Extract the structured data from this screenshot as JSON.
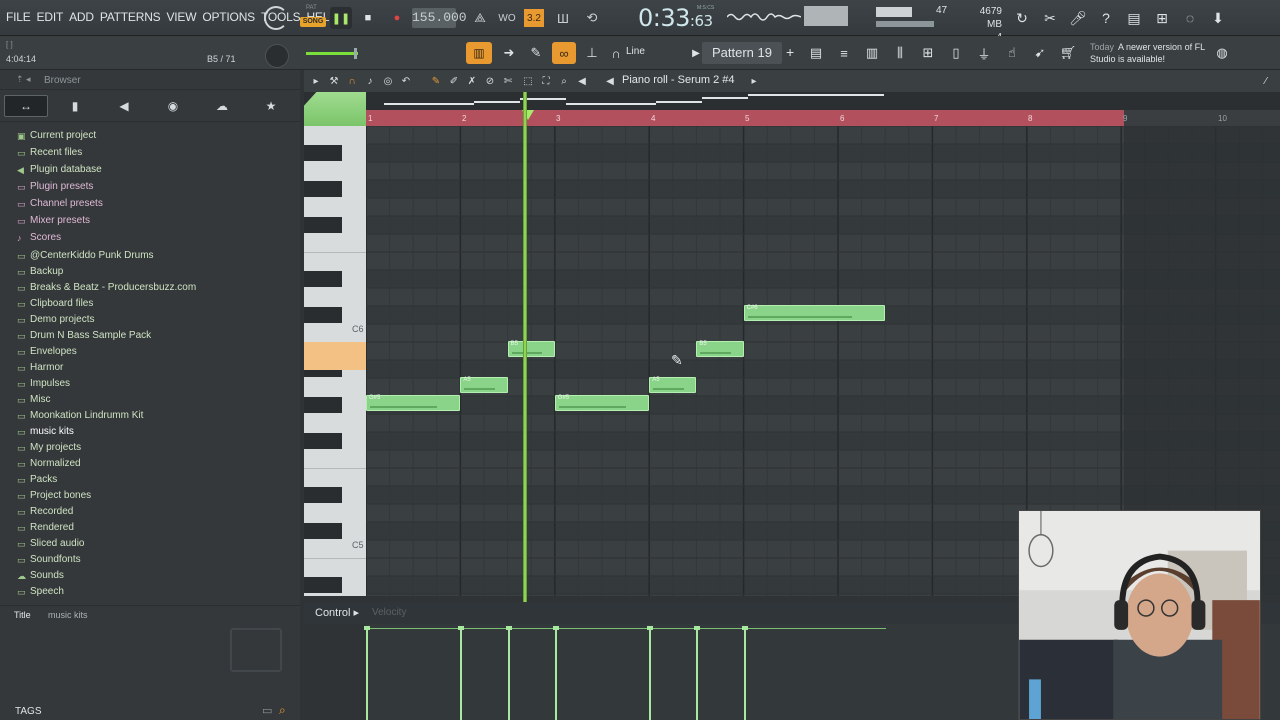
{
  "menu": [
    "FILE",
    "EDIT",
    "ADD",
    "PATTERNS",
    "VIEW",
    "OPTIONS",
    "TOOLS",
    "HELP"
  ],
  "transport": {
    "pat_label": "PAT",
    "song_label": "SONG",
    "tempo": "155.000"
  },
  "time": {
    "main": "0:33",
    "frac": ":63",
    "label": "M:S:CS"
  },
  "cpu": {
    "value": "47"
  },
  "memory": {
    "mb": "4679 MB",
    "poly": "4"
  },
  "hint": {
    "small": "[ ]",
    "left": "4:04:14",
    "right": "B5 / 71"
  },
  "snap": {
    "label": "Line"
  },
  "pattern": {
    "name": "Pattern 19",
    "plus": "+"
  },
  "news": {
    "date": "Today",
    "text": "A newer version of FL Studio is available!"
  },
  "browser": {
    "title": "Browser",
    "items": [
      {
        "label": "Current project",
        "icon": "project-icon",
        "color": "#cfe3c2"
      },
      {
        "label": "Recent files",
        "icon": "folder-icon",
        "color": "#cfe3c2"
      },
      {
        "label": "Plugin database",
        "icon": "plug-icon",
        "color": "#cfe3c2"
      },
      {
        "label": "Plugin presets",
        "icon": "folder-icon",
        "color": "#e0b9d6"
      },
      {
        "label": "Channel presets",
        "icon": "folder-icon",
        "color": "#e0b9d6"
      },
      {
        "label": "Mixer presets",
        "icon": "folder-icon",
        "color": "#e0b9d6"
      },
      {
        "label": "Scores",
        "icon": "note-icon",
        "color": "#e0b9d6"
      },
      {
        "label": "@CenterKiddo Punk Drums",
        "icon": "folder-icon",
        "color": "#cfe3c2"
      },
      {
        "label": "Backup",
        "icon": "folder-icon",
        "color": "#cfe3c2"
      },
      {
        "label": "Breaks & Beatz - Producersbuzz.com",
        "icon": "folder-icon",
        "color": "#cfe3c2"
      },
      {
        "label": "Clipboard files",
        "icon": "folder-icon",
        "color": "#cfe3c2"
      },
      {
        "label": "Demo projects",
        "icon": "folder-icon",
        "color": "#cfe3c2"
      },
      {
        "label": "Drum N Bass Sample Pack",
        "icon": "folder-icon",
        "color": "#cfe3c2"
      },
      {
        "label": "Envelopes",
        "icon": "folder-icon",
        "color": "#cfe3c2"
      },
      {
        "label": "Harmor",
        "icon": "folder-icon",
        "color": "#cfe3c2"
      },
      {
        "label": "Impulses",
        "icon": "folder-icon",
        "color": "#cfe3c2"
      },
      {
        "label": "Misc",
        "icon": "folder-icon",
        "color": "#cfe3c2"
      },
      {
        "label": "Moonkation Lindrumm Kit",
        "icon": "folder-icon",
        "color": "#cfe3c2"
      },
      {
        "label": "music kits",
        "icon": "folder-icon",
        "color": "#ffffff"
      },
      {
        "label": "My projects",
        "icon": "folder-icon",
        "color": "#cfe3c2"
      },
      {
        "label": "Normalized",
        "icon": "folder-icon",
        "color": "#cfe3c2"
      },
      {
        "label": "Packs",
        "icon": "folder-icon",
        "color": "#cfe3c2"
      },
      {
        "label": "Project bones",
        "icon": "folder-icon",
        "color": "#cfe3c2"
      },
      {
        "label": "Recorded",
        "icon": "folder-icon",
        "color": "#cfe3c2"
      },
      {
        "label": "Rendered",
        "icon": "folder-icon",
        "color": "#cfe3c2"
      },
      {
        "label": "Sliced audio",
        "icon": "folder-icon",
        "color": "#cfe3c2"
      },
      {
        "label": "Soundfonts",
        "icon": "folder-icon",
        "color": "#cfe3c2"
      },
      {
        "label": "Sounds",
        "icon": "cloud-icon",
        "color": "#cfe3c2"
      },
      {
        "label": "Speech",
        "icon": "folder-icon",
        "color": "#cfe3c2"
      }
    ],
    "footer_title": "Title",
    "footer_value": "music kits",
    "tags": "TAGS"
  },
  "piano_roll": {
    "title": "Piano roll - Serum 2 #4",
    "bars": [
      "1",
      "2",
      "3",
      "4",
      "5",
      "6",
      "7",
      "8",
      "9",
      "10"
    ],
    "key_labels": {
      "c6": "C6",
      "c5": "C5"
    },
    "notes": [
      {
        "pitch": "G#5",
        "start": 1.0,
        "length": 1.0,
        "velocity": 0.78
      },
      {
        "pitch": "A5",
        "start": 2.0,
        "length": 0.5,
        "velocity": 0.78
      },
      {
        "pitch": "B5",
        "start": 2.5,
        "length": 0.5,
        "velocity": 0.78
      },
      {
        "pitch": "G#5",
        "start": 3.0,
        "length": 1.0,
        "velocity": 0.78
      },
      {
        "pitch": "A5",
        "start": 4.0,
        "length": 0.5,
        "velocity": 0.78
      },
      {
        "pitch": "B5",
        "start": 4.5,
        "length": 0.5,
        "velocity": 0.78
      },
      {
        "pitch": "C#6",
        "start": 5.0,
        "length": 1.5,
        "velocity": 0.78
      }
    ]
  },
  "control": {
    "label": "Control",
    "sub": "Velocity"
  },
  "colors": {
    "accent": "#e89a31",
    "note": "#8ad48a",
    "playhead": "#a8e86a",
    "ruler": "#b3505e"
  }
}
